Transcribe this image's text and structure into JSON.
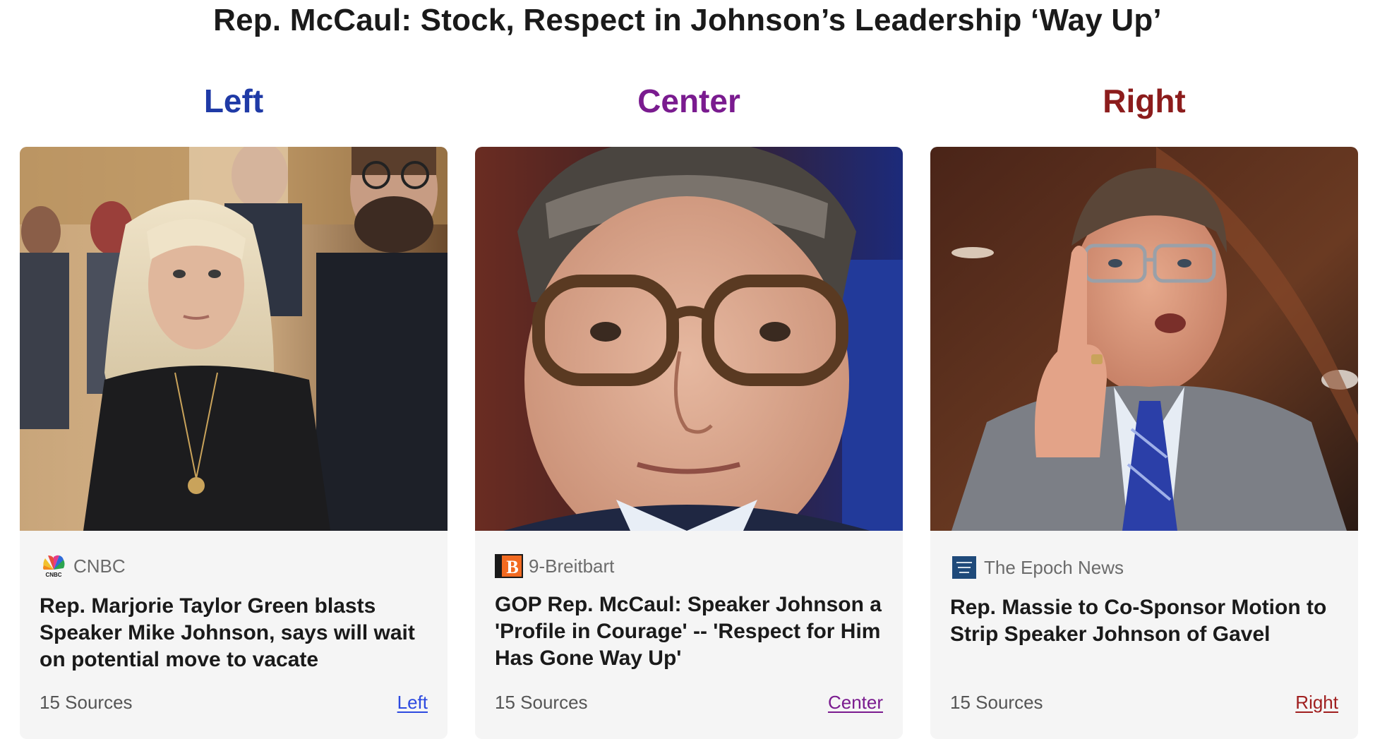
{
  "page": {
    "title": "Rep. McCaul: Stock, Respect in Johnson’s Leadership ‘Way Up’"
  },
  "columns": [
    {
      "heading": "Left",
      "heading_color": "#1f3aa6",
      "source": {
        "name": "CNBC",
        "logo_icon": "cnbc-peacock-icon",
        "logo_text": "CNBC"
      },
      "headline": "Rep. Marjorie Taylor Green blasts Speaker Mike Johnson, says will wait on potential move to vacate",
      "sources_count": "15 Sources",
      "bias_link": "Left",
      "bias_color": "#2d4ae0"
    },
    {
      "heading": "Center",
      "heading_color": "#7a1b8f",
      "source": {
        "name": "9-Breitbart",
        "logo_icon": "breitbart-b-icon",
        "logo_text": "B"
      },
      "headline": "GOP Rep. McCaul: Speaker Johnson a 'Profile in Courage' -- 'Respect for Him Has Gone Way Up'",
      "sources_count": "15 Sources",
      "bias_link": "Center",
      "bias_color": "#7a1b8f"
    },
    {
      "heading": "Right",
      "heading_color": "#8c1c1c",
      "source": {
        "name": "The Epoch News",
        "logo_icon": "epoch-times-icon"
      },
      "headline": "Rep. Massie to Co-Sponsor Motion to Strip Speaker Johnson of Gavel",
      "sources_count": "15 Sources",
      "bias_link": "Right",
      "bias_color": "#a01f1f"
    }
  ]
}
